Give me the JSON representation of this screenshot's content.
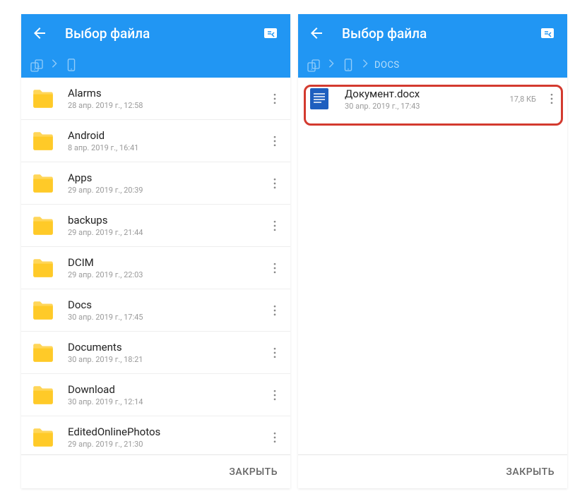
{
  "colors": {
    "primary": "#2196f3"
  },
  "left": {
    "title": "Выбор файла",
    "close_label": "ЗАКРЫТЬ",
    "items": [
      {
        "name": "Alarms",
        "sub": "28 апр. 2019 г., 12:58"
      },
      {
        "name": "Android",
        "sub": "8 апр. 2019 г., 16:41"
      },
      {
        "name": "Apps",
        "sub": "29 апр. 2019 г., 20:39"
      },
      {
        "name": "backups",
        "sub": "29 апр. 2019 г., 21:44"
      },
      {
        "name": "DCIM",
        "sub": "29 апр. 2019 г., 22:03"
      },
      {
        "name": "Docs",
        "sub": "30 апр. 2019 г., 17:45"
      },
      {
        "name": "Documents",
        "sub": "30 апр. 2019 г., 18:21"
      },
      {
        "name": "Download",
        "sub": "30 апр. 2019 г., 12:14"
      },
      {
        "name": "EditedOnlinePhotos",
        "sub": "29 апр. 2019 г., 21:30"
      }
    ]
  },
  "right": {
    "title": "Выбор файла",
    "close_label": "ЗАКРЫТЬ",
    "breadcrumb_folder": "DOCS",
    "items": [
      {
        "name": "Документ.docx",
        "sub": "30 апр. 2019 г., 17:43",
        "size": "17,8 КБ"
      }
    ]
  }
}
